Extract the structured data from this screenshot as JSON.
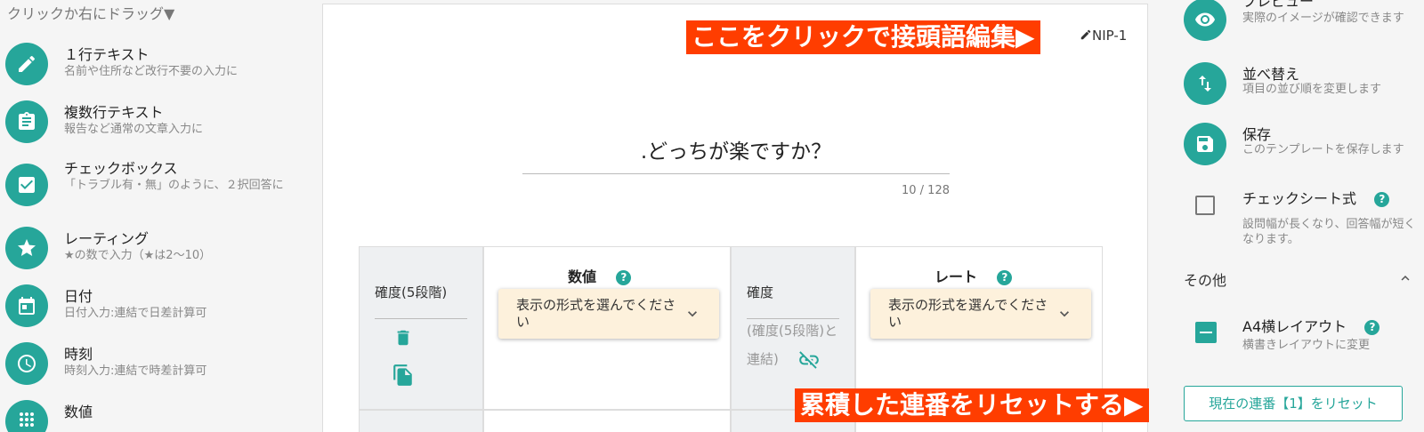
{
  "left": {
    "hint": "クリックか右にドラッグ▼",
    "items": [
      {
        "title": "１行テキスト",
        "desc": "名前や住所など改行不要の入力に",
        "icon": "pencil-icon"
      },
      {
        "title": "複数行テキスト",
        "desc": "報告など通常の文章入力に",
        "icon": "clipboard-icon"
      },
      {
        "title": "チェックボックス",
        "desc": "「トラブル有・無」のように、２択回答に",
        "icon": "checkbox-icon"
      },
      {
        "title": "レーティング",
        "desc": "★の数で入力（★は2〜10）",
        "icon": "star-icon"
      },
      {
        "title": "日付",
        "desc": "日付入力:連結で日差計算可",
        "icon": "calendar-icon"
      },
      {
        "title": "時刻",
        "desc": "時刻入力:連結で時差計算可",
        "icon": "clock-icon"
      },
      {
        "title": "数値",
        "desc": "",
        "icon": "dialpad-icon"
      }
    ]
  },
  "editor": {
    "prefix_banner": "ここをクリックで接頭語編集▶",
    "prefix_label": "NIP-1",
    "question_title": ".どっちが楽ですか？",
    "char_count": "10 / 128",
    "rows": [
      {
        "left_label": "確度(5段階)",
        "col1_header": "数値",
        "col1_select": "表示の形式を選んでください",
        "mid_label": "確度",
        "mid_linked": "(確度(5段階)と連結)",
        "col2_header": "レート",
        "col2_select": "表示の形式を選んでください"
      }
    ],
    "help_mark": "?"
  },
  "right": {
    "items": [
      {
        "title": "プレビュー",
        "desc": "実際のイメージが確認できます",
        "icon": "eye-icon"
      },
      {
        "title": "並べ替え",
        "desc": "項目の並び順を変更します",
        "icon": "sort-icon"
      },
      {
        "title": "保存",
        "desc": "このテンプレートを保存します",
        "icon": "save-icon"
      }
    ],
    "check_sheet": {
      "title": "チェックシート式",
      "desc": "設問幅が長くなり、回答幅が短くなります。"
    },
    "section_label": "その他",
    "a4": {
      "title": "A4横レイアウト",
      "desc": "横書きレイアウトに変更"
    },
    "reset_banner": "累積した連番をリセットする▶",
    "reset_button": "現在の連番【1】をリセット"
  },
  "colors": {
    "accent": "#26a69a",
    "banner": "#ff3d00",
    "select_bg": "#fdf1dc"
  }
}
